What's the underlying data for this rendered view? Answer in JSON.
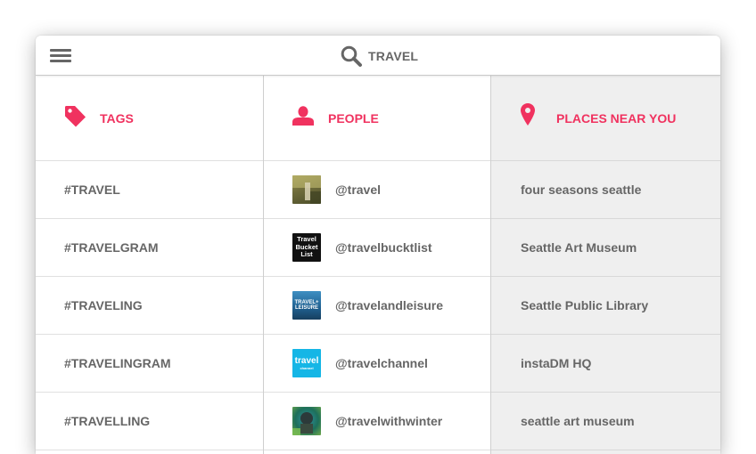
{
  "header": {
    "search_query": "TRAVEL"
  },
  "columns": {
    "tags": {
      "title": "TAGS",
      "items": [
        "#TRAVEL",
        "#TRAVELGRAM",
        "#TRAVELING",
        "#TRAVELINGRAM",
        "#TRAVELLING"
      ]
    },
    "people": {
      "title": "PEOPLE",
      "items": [
        {
          "handle": "@travel"
        },
        {
          "handle": "@travelbucktlist",
          "avatar_text": [
            "Travel",
            "Bucket",
            "List"
          ]
        },
        {
          "handle": "@travelandleisure",
          "avatar_text": [
            "TRAVEL+",
            "LEISURE"
          ]
        },
        {
          "handle": "@travelchannel",
          "avatar_text": [
            "travel",
            "channel"
          ]
        },
        {
          "handle": "@travelwithwinter"
        }
      ]
    },
    "places": {
      "title": "PLACES NEAR YOU",
      "items": [
        "four seasons seattle",
        "Seattle Art Museum",
        "Seattle Public Library",
        "instaDM HQ",
        "seattle art museum"
      ]
    }
  },
  "colors": {
    "accent": "#f0325f",
    "text": "#666666",
    "places_bg": "#efefef"
  },
  "icons": [
    "menu-icon",
    "search-icon",
    "tag-icon",
    "person-icon",
    "location-pin-icon"
  ]
}
